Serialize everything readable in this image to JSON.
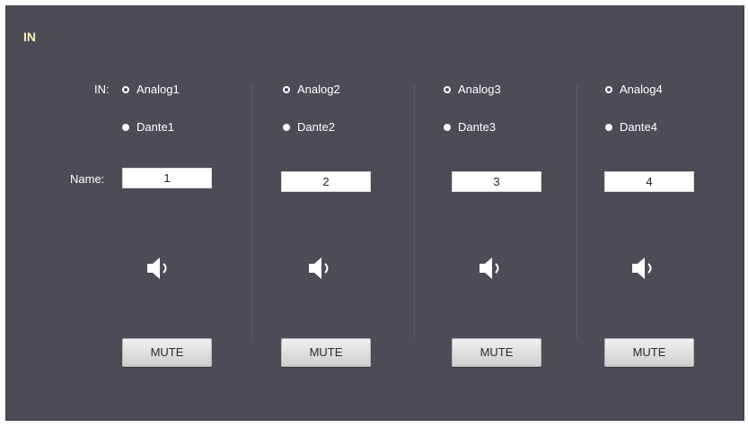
{
  "panel": {
    "title": "IN",
    "in_label": "IN:",
    "name_label": "Name:"
  },
  "channels": [
    {
      "analog": "Analog1",
      "dante": "Dante1",
      "name": "1",
      "mute": "MUTE",
      "selected": "dante"
    },
    {
      "analog": "Analog2",
      "dante": "Dante2",
      "name": "2",
      "mute": "MUTE",
      "selected": "dante"
    },
    {
      "analog": "Analog3",
      "dante": "Dante3",
      "name": "3",
      "mute": "MUTE",
      "selected": "dante"
    },
    {
      "analog": "Analog4",
      "dante": "Dante4",
      "name": "4",
      "mute": "MUTE",
      "selected": "dante"
    }
  ],
  "icons": {
    "speaker": "speaker-icon"
  }
}
